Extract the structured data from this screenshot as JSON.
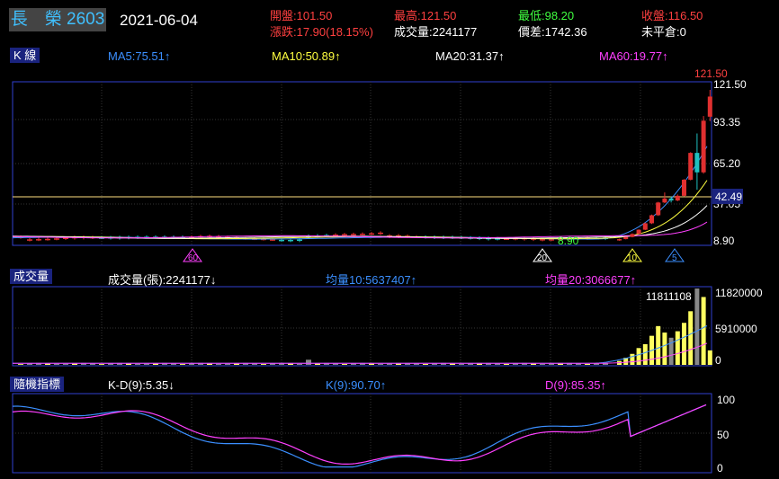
{
  "header": {
    "stock_name": "長　榮 2603",
    "date": "2021-06-04",
    "open": "開盤:101.50",
    "change": "漲跌:17.90(18.15%)",
    "high": "最高:121.50",
    "volume": "成交量:2241177",
    "low": "最低:98.20",
    "spread": "價差:1742.36",
    "close": "收盤:116.50",
    "open_interest": "未平倉:0"
  },
  "kline": {
    "tag": "K 線",
    "ma5": "MA5:75.51↑",
    "ma10": "MA10:50.89↑",
    "ma20": "MA20:31.37↑",
    "ma60": "MA60:19.77↑",
    "axis_ticks": [
      "121.50",
      "93.35",
      "65.20",
      "37.05",
      "8.90"
    ],
    "last_price_label": "42.49",
    "high_label": "121.50",
    "low_label": "8.90",
    "markers": [
      "60",
      "20",
      "10",
      "5"
    ],
    "colors": {
      "up": "#e03030",
      "down": "#20c0c0",
      "ma5": "#3b8fff",
      "ma10": "#ffff40",
      "ma20": "#ffffff",
      "ma60": "#ff40ff",
      "ref_line": "#ffe080"
    }
  },
  "volume": {
    "tag": "成交量",
    "total": "成交量(張):2241177↓",
    "avg10": "均量10:5637407↑",
    "avg20": "均量20:3066677↑",
    "axis_ticks": [
      "11820000",
      "5910000",
      "0"
    ],
    "peak_label": "11811108"
  },
  "kd": {
    "tag": "隨機指標",
    "kd_diff": "K-D(9):5.35↓",
    "k": "K(9):90.70↑",
    "d": "D(9):85.35↑",
    "axis_ticks": [
      "100",
      "50",
      "0"
    ]
  },
  "chart_data": {
    "type": "candlestick",
    "price_range": [
      8.9,
      121.5
    ],
    "reference_price": 42.49,
    "candles_recent": [
      {
        "open": 9.5,
        "high": 10.5,
        "low": 9.0,
        "close": 10.2
      },
      {
        "open": 10.2,
        "high": 12.0,
        "low": 10.0,
        "close": 11.8
      },
      {
        "open": 11.8,
        "high": 14.5,
        "low": 11.5,
        "close": 14.0
      },
      {
        "open": 14.0,
        "high": 17.5,
        "low": 13.8,
        "close": 17.2
      },
      {
        "open": 17.2,
        "high": 22.5,
        "low": 17.0,
        "close": 22.0
      },
      {
        "open": 22.0,
        "high": 28.5,
        "low": 21.5,
        "close": 28.0
      },
      {
        "open": 28.0,
        "high": 38.0,
        "low": 27.5,
        "close": 37.5
      },
      {
        "open": 37.5,
        "high": 45.0,
        "low": 37.0,
        "close": 40.5
      },
      {
        "open": 40.5,
        "high": 42.0,
        "low": 37.5,
        "close": 39.0
      },
      {
        "open": 39.0,
        "high": 43.5,
        "low": 38.5,
        "close": 42.5
      },
      {
        "open": 42.5,
        "high": 55.0,
        "low": 42.0,
        "close": 54.5
      },
      {
        "open": 54.5,
        "high": 75.0,
        "low": 54.0,
        "close": 74.5
      },
      {
        "open": 74.5,
        "high": 89.0,
        "low": 47.0,
        "close": 60.0
      },
      {
        "open": 60.0,
        "high": 102.0,
        "low": 59.0,
        "close": 98.5
      },
      {
        "open": 101.5,
        "high": 121.5,
        "low": 98.2,
        "close": 116.5
      }
    ],
    "volume_range": [
      0,
      11820000
    ],
    "volume_recent": [
      600000,
      1100000,
      1700000,
      2600000,
      3200000,
      4500000,
      6000000,
      5000000,
      4200000,
      5200000,
      6500000,
      8300000,
      11811108,
      10500000,
      2241177
    ],
    "kd_range": [
      0,
      100
    ]
  }
}
